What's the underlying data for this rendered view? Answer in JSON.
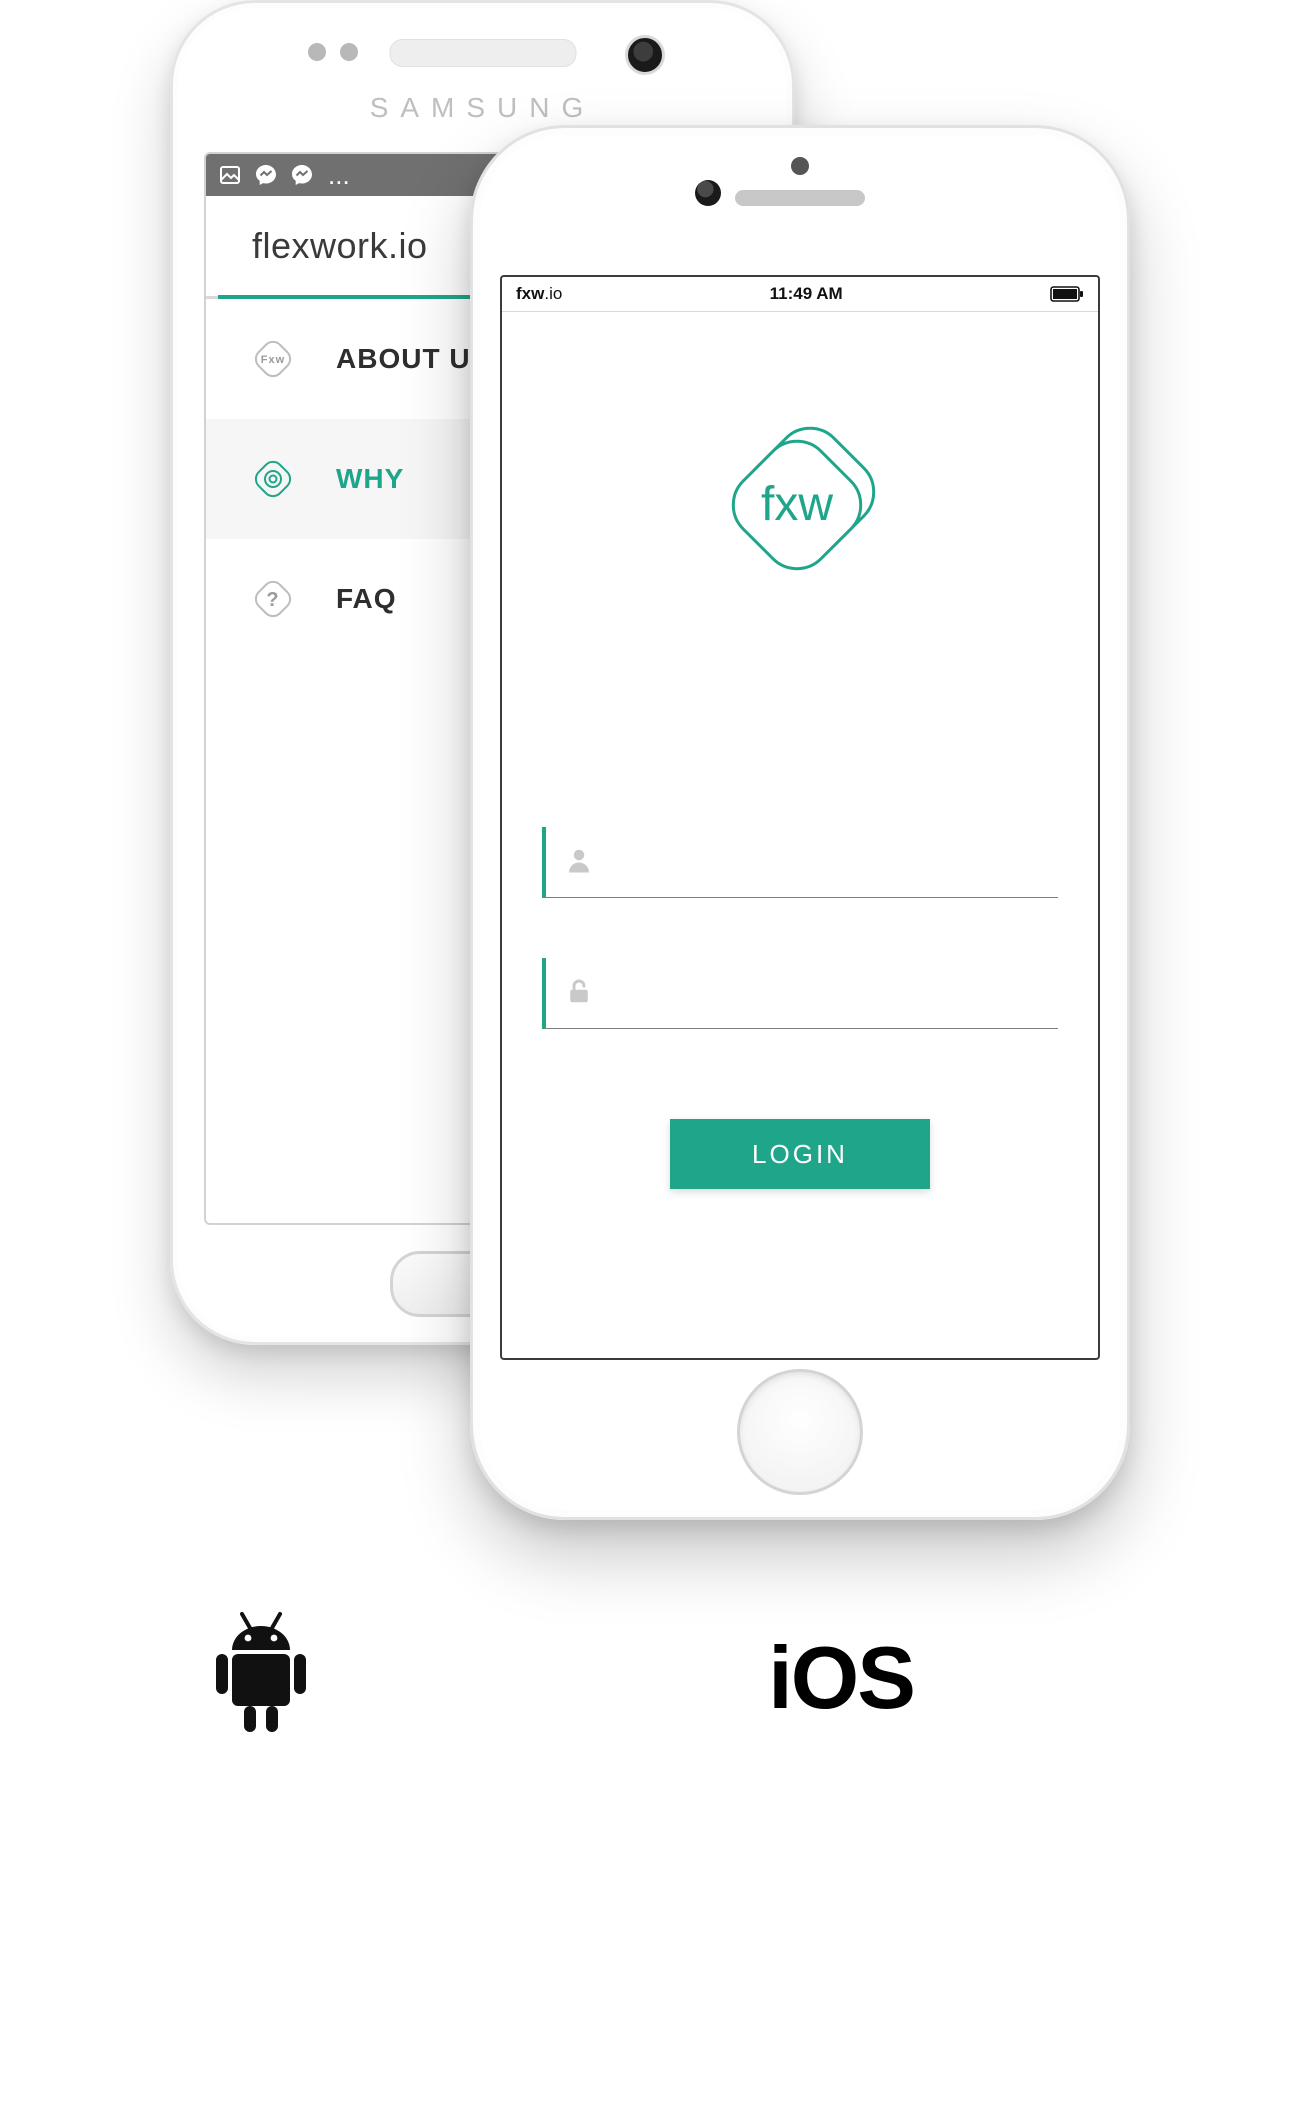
{
  "colors": {
    "accent": "#1fa68a"
  },
  "android": {
    "brand": "SAMSUNG",
    "status_ellipsis": "...",
    "title": "flexwork.io",
    "menu": [
      {
        "label": "ABOUT US",
        "active": false
      },
      {
        "label": "WHY",
        "active": true
      },
      {
        "label": "FAQ",
        "active": false
      }
    ]
  },
  "iphone": {
    "status": {
      "carrier_bold": "fxw",
      "carrier_suffix": ".io",
      "time": "11:49 AM"
    },
    "logo_text": "fxw",
    "username": "",
    "password": "",
    "login_label": "LOGIN"
  },
  "os_labels": {
    "ios": "iOS"
  }
}
